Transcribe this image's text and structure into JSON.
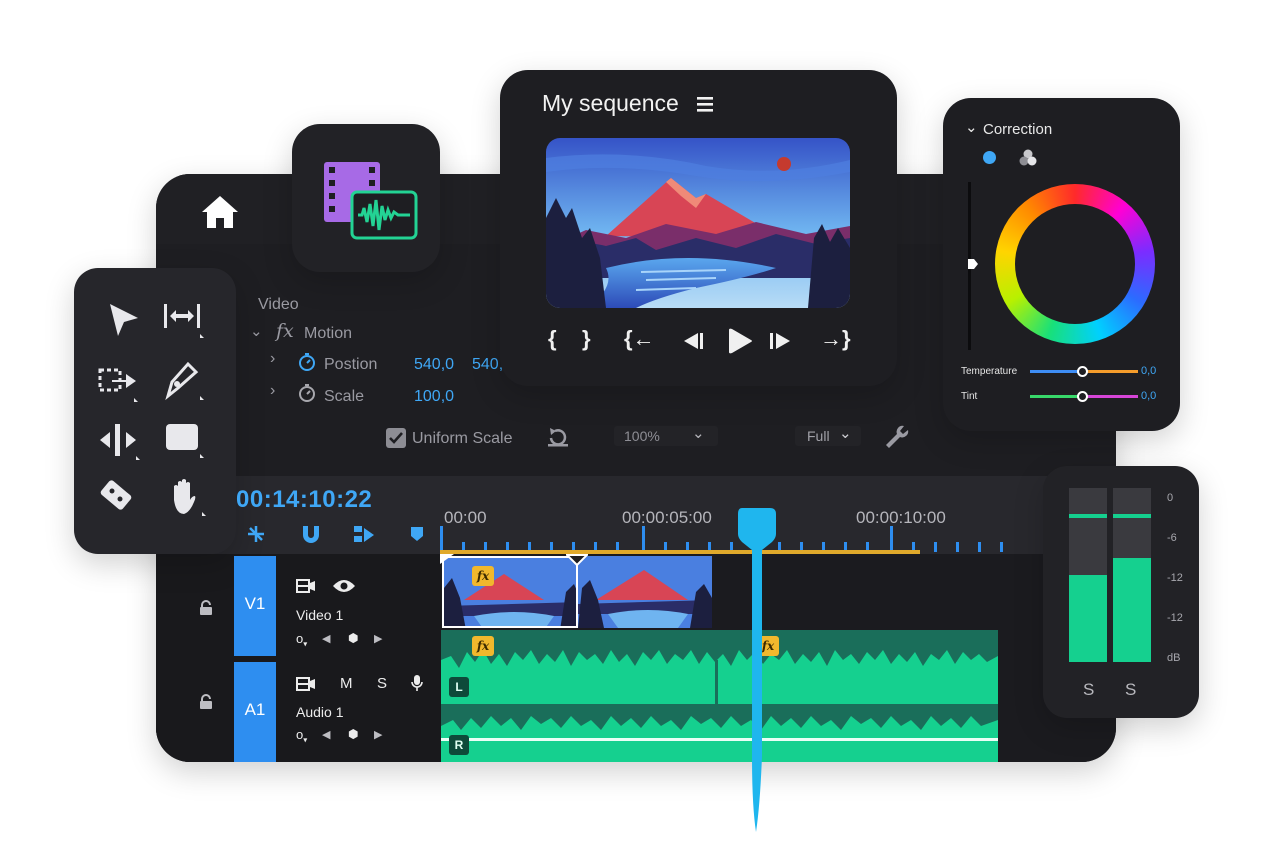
{
  "effect_controls": {
    "section": "Video",
    "motion": "Motion",
    "position_label": "Postion",
    "position_x": "540,0",
    "position_y": "540,",
    "scale_label": "Scale",
    "scale_value": "100,0",
    "uniform_scale": "Uniform Scale",
    "uniform_scale_checked": true,
    "zoom": "100%",
    "quality": "Full"
  },
  "monitor": {
    "title": "My sequence"
  },
  "color": {
    "header": "Correction",
    "temperature_label": "Temperature",
    "temperature_value": "0,0",
    "tint_label": "Tint",
    "tint_value": "0,0"
  },
  "timeline": {
    "timecode": "00:14:10:22",
    "ruler": [
      "00:00",
      "00:00:05:00",
      "00:00:10:00"
    ],
    "tracks": [
      {
        "id": "V1",
        "name": "Video 1"
      },
      {
        "id": "A1",
        "name": "Audio 1"
      }
    ],
    "audio_buttons": {
      "mute": "M",
      "solo": "S"
    },
    "channel_left": "L",
    "channel_right": "R",
    "fx_badge": "fx"
  },
  "meter": {
    "scale": [
      "0",
      "-6",
      "-12",
      "-12",
      "dB"
    ],
    "solo_left": "S",
    "solo_right": "S",
    "level_left": 0.5,
    "level_right": 0.6
  },
  "colors": {
    "accent": "#3fa7f5",
    "audio": "#15d08f",
    "clip_bar": "#e0a92b"
  }
}
